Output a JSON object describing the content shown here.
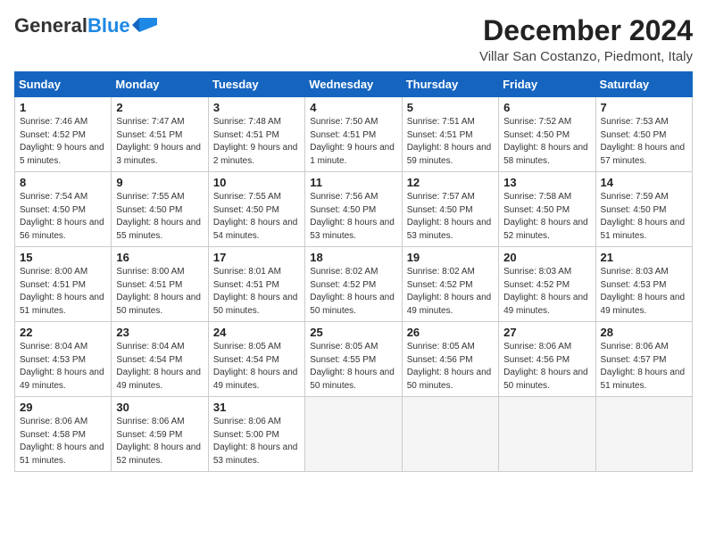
{
  "logo": {
    "general": "General",
    "blue": "Blue"
  },
  "title": "December 2024",
  "location": "Villar San Costanzo, Piedmont, Italy",
  "weekdays": [
    "Sunday",
    "Monday",
    "Tuesday",
    "Wednesday",
    "Thursday",
    "Friday",
    "Saturday"
  ],
  "weeks": [
    [
      {
        "day": "1",
        "sunrise": "Sunrise: 7:46 AM",
        "sunset": "Sunset: 4:52 PM",
        "daylight": "Daylight: 9 hours and 5 minutes."
      },
      {
        "day": "2",
        "sunrise": "Sunrise: 7:47 AM",
        "sunset": "Sunset: 4:51 PM",
        "daylight": "Daylight: 9 hours and 3 minutes."
      },
      {
        "day": "3",
        "sunrise": "Sunrise: 7:48 AM",
        "sunset": "Sunset: 4:51 PM",
        "daylight": "Daylight: 9 hours and 2 minutes."
      },
      {
        "day": "4",
        "sunrise": "Sunrise: 7:50 AM",
        "sunset": "Sunset: 4:51 PM",
        "daylight": "Daylight: 9 hours and 1 minute."
      },
      {
        "day": "5",
        "sunrise": "Sunrise: 7:51 AM",
        "sunset": "Sunset: 4:51 PM",
        "daylight": "Daylight: 8 hours and 59 minutes."
      },
      {
        "day": "6",
        "sunrise": "Sunrise: 7:52 AM",
        "sunset": "Sunset: 4:50 PM",
        "daylight": "Daylight: 8 hours and 58 minutes."
      },
      {
        "day": "7",
        "sunrise": "Sunrise: 7:53 AM",
        "sunset": "Sunset: 4:50 PM",
        "daylight": "Daylight: 8 hours and 57 minutes."
      }
    ],
    [
      {
        "day": "8",
        "sunrise": "Sunrise: 7:54 AM",
        "sunset": "Sunset: 4:50 PM",
        "daylight": "Daylight: 8 hours and 56 minutes."
      },
      {
        "day": "9",
        "sunrise": "Sunrise: 7:55 AM",
        "sunset": "Sunset: 4:50 PM",
        "daylight": "Daylight: 8 hours and 55 minutes."
      },
      {
        "day": "10",
        "sunrise": "Sunrise: 7:55 AM",
        "sunset": "Sunset: 4:50 PM",
        "daylight": "Daylight: 8 hours and 54 minutes."
      },
      {
        "day": "11",
        "sunrise": "Sunrise: 7:56 AM",
        "sunset": "Sunset: 4:50 PM",
        "daylight": "Daylight: 8 hours and 53 minutes."
      },
      {
        "day": "12",
        "sunrise": "Sunrise: 7:57 AM",
        "sunset": "Sunset: 4:50 PM",
        "daylight": "Daylight: 8 hours and 53 minutes."
      },
      {
        "day": "13",
        "sunrise": "Sunrise: 7:58 AM",
        "sunset": "Sunset: 4:50 PM",
        "daylight": "Daylight: 8 hours and 52 minutes."
      },
      {
        "day": "14",
        "sunrise": "Sunrise: 7:59 AM",
        "sunset": "Sunset: 4:50 PM",
        "daylight": "Daylight: 8 hours and 51 minutes."
      }
    ],
    [
      {
        "day": "15",
        "sunrise": "Sunrise: 8:00 AM",
        "sunset": "Sunset: 4:51 PM",
        "daylight": "Daylight: 8 hours and 51 minutes."
      },
      {
        "day": "16",
        "sunrise": "Sunrise: 8:00 AM",
        "sunset": "Sunset: 4:51 PM",
        "daylight": "Daylight: 8 hours and 50 minutes."
      },
      {
        "day": "17",
        "sunrise": "Sunrise: 8:01 AM",
        "sunset": "Sunset: 4:51 PM",
        "daylight": "Daylight: 8 hours and 50 minutes."
      },
      {
        "day": "18",
        "sunrise": "Sunrise: 8:02 AM",
        "sunset": "Sunset: 4:52 PM",
        "daylight": "Daylight: 8 hours and 50 minutes."
      },
      {
        "day": "19",
        "sunrise": "Sunrise: 8:02 AM",
        "sunset": "Sunset: 4:52 PM",
        "daylight": "Daylight: 8 hours and 49 minutes."
      },
      {
        "day": "20",
        "sunrise": "Sunrise: 8:03 AM",
        "sunset": "Sunset: 4:52 PM",
        "daylight": "Daylight: 8 hours and 49 minutes."
      },
      {
        "day": "21",
        "sunrise": "Sunrise: 8:03 AM",
        "sunset": "Sunset: 4:53 PM",
        "daylight": "Daylight: 8 hours and 49 minutes."
      }
    ],
    [
      {
        "day": "22",
        "sunrise": "Sunrise: 8:04 AM",
        "sunset": "Sunset: 4:53 PM",
        "daylight": "Daylight: 8 hours and 49 minutes."
      },
      {
        "day": "23",
        "sunrise": "Sunrise: 8:04 AM",
        "sunset": "Sunset: 4:54 PM",
        "daylight": "Daylight: 8 hours and 49 minutes."
      },
      {
        "day": "24",
        "sunrise": "Sunrise: 8:05 AM",
        "sunset": "Sunset: 4:54 PM",
        "daylight": "Daylight: 8 hours and 49 minutes."
      },
      {
        "day": "25",
        "sunrise": "Sunrise: 8:05 AM",
        "sunset": "Sunset: 4:55 PM",
        "daylight": "Daylight: 8 hours and 50 minutes."
      },
      {
        "day": "26",
        "sunrise": "Sunrise: 8:05 AM",
        "sunset": "Sunset: 4:56 PM",
        "daylight": "Daylight: 8 hours and 50 minutes."
      },
      {
        "day": "27",
        "sunrise": "Sunrise: 8:06 AM",
        "sunset": "Sunset: 4:56 PM",
        "daylight": "Daylight: 8 hours and 50 minutes."
      },
      {
        "day": "28",
        "sunrise": "Sunrise: 8:06 AM",
        "sunset": "Sunset: 4:57 PM",
        "daylight": "Daylight: 8 hours and 51 minutes."
      }
    ],
    [
      {
        "day": "29",
        "sunrise": "Sunrise: 8:06 AM",
        "sunset": "Sunset: 4:58 PM",
        "daylight": "Daylight: 8 hours and 51 minutes."
      },
      {
        "day": "30",
        "sunrise": "Sunrise: 8:06 AM",
        "sunset": "Sunset: 4:59 PM",
        "daylight": "Daylight: 8 hours and 52 minutes."
      },
      {
        "day": "31",
        "sunrise": "Sunrise: 8:06 AM",
        "sunset": "Sunset: 5:00 PM",
        "daylight": "Daylight: 8 hours and 53 minutes."
      },
      null,
      null,
      null,
      null
    ]
  ]
}
